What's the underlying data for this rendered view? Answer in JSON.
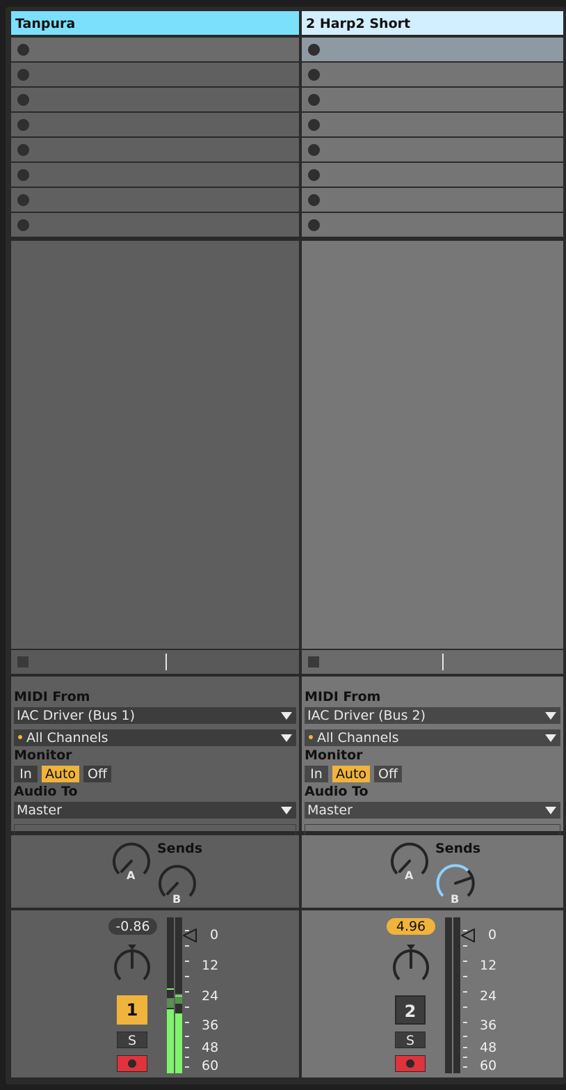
{
  "tracks": [
    {
      "title": "Tanpura",
      "midi_from_label": "MIDI From",
      "input_source": "IAC Driver (Bus 1)",
      "channel": "All Channels",
      "monitor_label": "Monitor",
      "monitor": [
        "In",
        "Auto",
        "Off"
      ],
      "monitor_selected": "Auto",
      "audio_to_label": "Audio To",
      "output": "Master",
      "sends_label": "Sends",
      "send_a": "A",
      "send_b": "B",
      "volume": "-0.86",
      "number": "1",
      "solo": "S"
    },
    {
      "title": "2 Harp2 Short",
      "midi_from_label": "MIDI From",
      "input_source": "IAC Driver (Bus 2)",
      "channel": "All Channels",
      "monitor_label": "Monitor",
      "monitor": [
        "In",
        "Auto",
        "Off"
      ],
      "monitor_selected": "Auto",
      "audio_to_label": "Audio To",
      "output": "Master",
      "sends_label": "Sends",
      "send_a": "A",
      "send_b": "B",
      "volume": "4.96",
      "number": "2",
      "solo": "S"
    }
  ],
  "meter_scale": [
    "0",
    "12",
    "24",
    "36",
    "48",
    "60"
  ],
  "colors": {
    "track1_title": "#7be0fb",
    "track2_title": "#d2efff",
    "accent": "#f0b33c",
    "arm": "#e0333b",
    "meter": "#7ef36c",
    "send_b_active": "#8fd0ff"
  }
}
